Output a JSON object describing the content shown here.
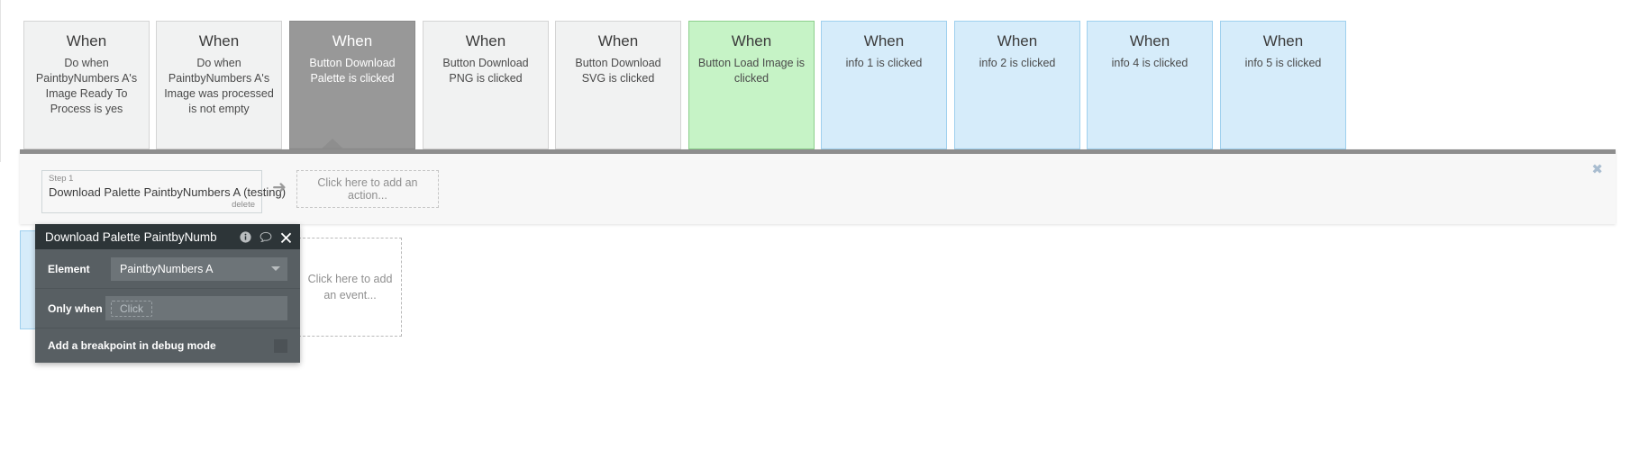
{
  "workflow": {
    "events": [
      {
        "when": "When",
        "desc": "Do when PaintbyNumbers A's Image Ready To Process is yes",
        "state": "default"
      },
      {
        "when": "When",
        "desc": "Do when PaintbyNumbers A's Image was processed is not empty",
        "state": "default"
      },
      {
        "when": "When",
        "desc": "Button Download Palette is clicked",
        "state": "selected"
      },
      {
        "when": "When",
        "desc": "Button Download PNG is clicked",
        "state": "default"
      },
      {
        "when": "When",
        "desc": "Button Download SVG is clicked",
        "state": "default"
      },
      {
        "when": "When",
        "desc": "Button Load Image is clicked",
        "state": "green"
      },
      {
        "when": "When",
        "desc": "info 1 is clicked",
        "state": "blue"
      },
      {
        "when": "When",
        "desc": "info 2 is clicked",
        "state": "blue"
      },
      {
        "when": "When",
        "desc": "info 4 is clicked",
        "state": "blue"
      },
      {
        "when": "When",
        "desc": "info 5 is clicked",
        "state": "blue"
      }
    ]
  },
  "step_panel": {
    "close_label": "✖",
    "step": {
      "label": "Step 1",
      "title": "Download Palette PaintbyNumbers A (testing)",
      "delete_label": "delete"
    },
    "arrow": "➜",
    "add_action_label": "Click here to add an action..."
  },
  "second_row": {
    "add_event_label": "Click here to add an event..."
  },
  "popup": {
    "title": "Download Palette PaintbyNumb",
    "icons": {
      "info": "info-icon",
      "comment": "comment-icon",
      "close": "close-icon"
    },
    "element_row": {
      "label": "Element",
      "value": "PaintbyNumbers A"
    },
    "only_when_row": {
      "label": "Only when",
      "placeholder": "Click"
    },
    "breakpoint_row": {
      "label": "Add a breakpoint in debug mode",
      "checked": false
    }
  },
  "colors": {
    "selected": "#989898",
    "green": "#c6f3c6",
    "blue": "#d6ecfa",
    "panel_border": "#8e8e8e",
    "popup_header": "#2d3538",
    "popup_body": "#585f63"
  }
}
